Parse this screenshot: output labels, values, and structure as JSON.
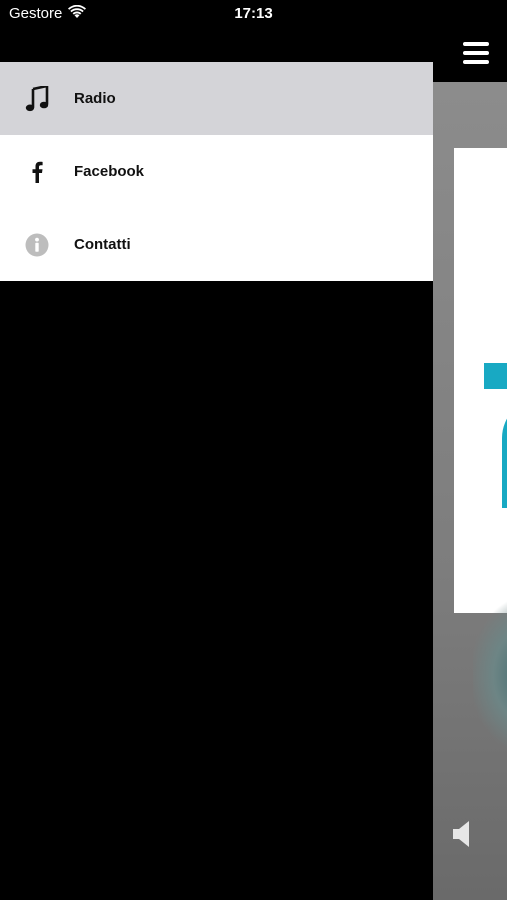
{
  "status_bar": {
    "carrier": "Gestore",
    "time": "17:13"
  },
  "menu": {
    "items": [
      {
        "label": "Radio",
        "icon": "music-note-icon",
        "active": true
      },
      {
        "label": "Facebook",
        "icon": "facebook-icon",
        "active": false
      },
      {
        "label": "Contatti",
        "icon": "info-icon",
        "active": false
      }
    ]
  },
  "colors": {
    "drawer_active_bg": "#d4d4d8",
    "drawer_bg": "#ffffff",
    "logo_accent": "#18a9c3",
    "background": "#000000"
  }
}
